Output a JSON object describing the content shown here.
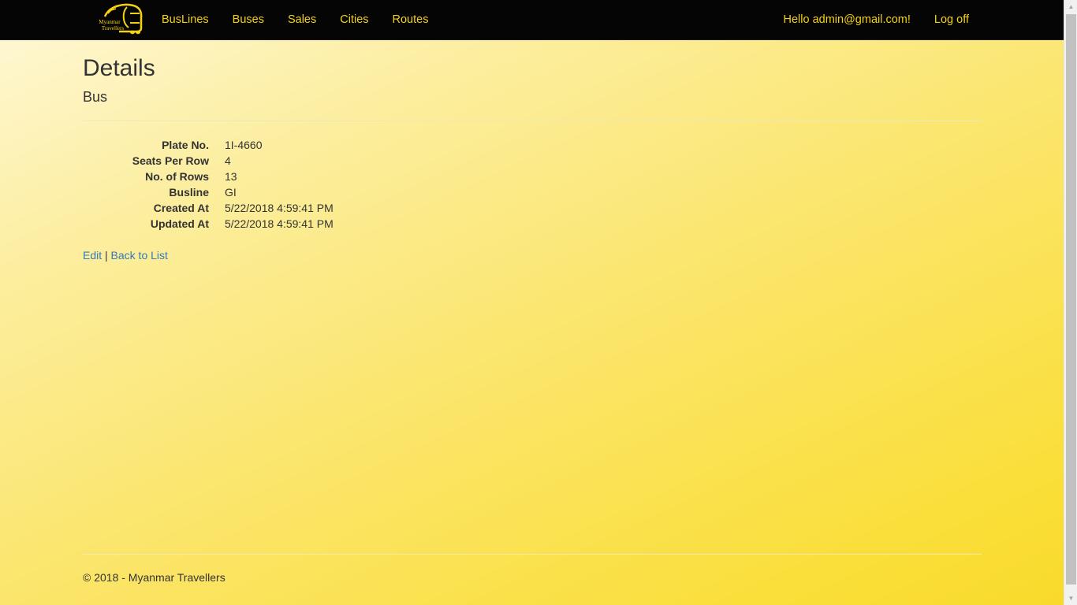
{
  "nav": {
    "brand": {
      "line1": "Myanmar",
      "line2": "Travellers",
      "color": "#f5d20f"
    },
    "links": [
      "BusLines",
      "Buses",
      "Sales",
      "Cities",
      "Routes"
    ],
    "greeting": "Hello admin@gmail.com!",
    "logoff": "Log off"
  },
  "page": {
    "title": "Details",
    "subtitle": "Bus"
  },
  "details": [
    {
      "label": "Plate No.",
      "value": "1I-4660"
    },
    {
      "label": "Seats Per Row",
      "value": "4"
    },
    {
      "label": "No. of Rows",
      "value": "13"
    },
    {
      "label": "Busline",
      "value": "GI"
    },
    {
      "label": "Created At",
      "value": "5/22/2018 4:59:41 PM"
    },
    {
      "label": "Updated At",
      "value": "5/22/2018 4:59:41 PM"
    }
  ],
  "actions": {
    "edit": "Edit",
    "separator": "|",
    "back": "Back to List"
  },
  "footer": {
    "text": "© 2018 - Myanmar Travellers"
  },
  "colors": {
    "nav_bg": "#050505",
    "nav_text": "#f5d20f",
    "link": "#337ab7"
  }
}
